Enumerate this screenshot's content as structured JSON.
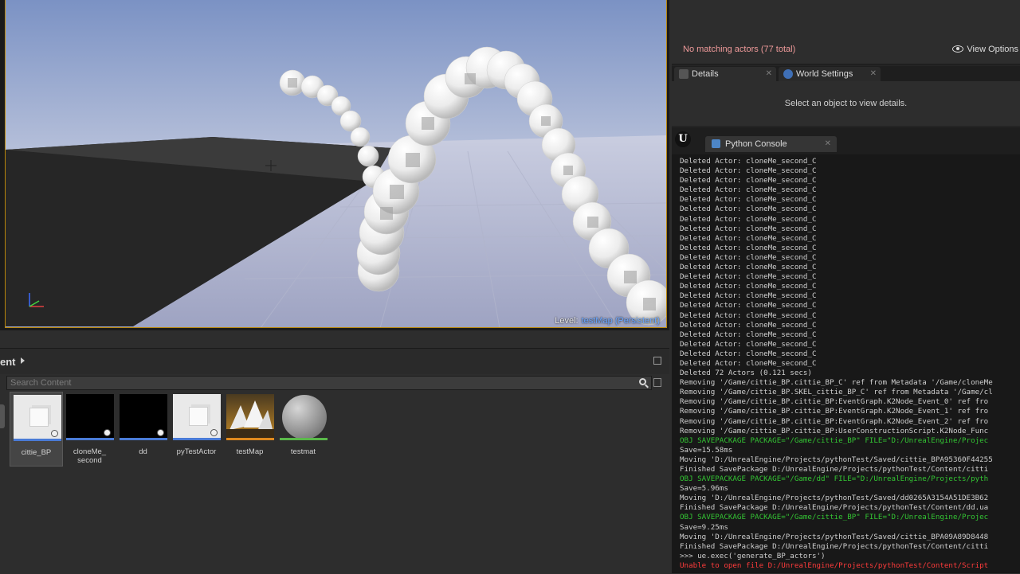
{
  "viewport": {
    "level_label": "Level:",
    "level_name": "testMap (Persistent)"
  },
  "content_browser": {
    "title": "ent",
    "search_placeholder": "Search Content",
    "assets": [
      {
        "label": "cittie_BP",
        "thumb": "blueprint-cube",
        "color": "#4a7bd6"
      },
      {
        "label": "cloneMe_\nsecond",
        "thumb": "blueprint-black",
        "color": "#4a7bd6"
      },
      {
        "label": "dd",
        "thumb": "blueprint-black",
        "color": "#4a7bd6"
      },
      {
        "label": "pyTestActor",
        "thumb": "blueprint-cube",
        "color": "#4a7bd6"
      },
      {
        "label": "testMap",
        "thumb": "map",
        "color": "#e08a1e"
      },
      {
        "label": "testmat",
        "thumb": "material-sphere",
        "color": "#5ab84a"
      }
    ]
  },
  "outliner": {
    "status": "No matching actors (77 total)",
    "view_options": "View Options"
  },
  "details": {
    "tabs": [
      "Details",
      "World Settings"
    ],
    "message": "Select an object to view details."
  },
  "python_console": {
    "tab_label": "Python Console",
    "lines": [
      {
        "text": "Deleted Actor: cloneMe_second_C",
        "kind": "normal"
      },
      {
        "text": "Deleted Actor: cloneMe_second_C",
        "kind": "normal"
      },
      {
        "text": "Deleted Actor: cloneMe_second_C",
        "kind": "normal"
      },
      {
        "text": "Deleted Actor: cloneMe_second_C",
        "kind": "normal"
      },
      {
        "text": "Deleted Actor: cloneMe_second_C",
        "kind": "normal"
      },
      {
        "text": "Deleted Actor: cloneMe_second_C",
        "kind": "normal"
      },
      {
        "text": "Deleted Actor: cloneMe_second_C",
        "kind": "normal"
      },
      {
        "text": "Deleted Actor: cloneMe_second_C",
        "kind": "normal"
      },
      {
        "text": "Deleted Actor: cloneMe_second_C",
        "kind": "normal"
      },
      {
        "text": "Deleted Actor: cloneMe_second_C",
        "kind": "normal"
      },
      {
        "text": "Deleted Actor: cloneMe_second_C",
        "kind": "normal"
      },
      {
        "text": "Deleted Actor: cloneMe_second_C",
        "kind": "normal"
      },
      {
        "text": "Deleted Actor: cloneMe_second_C",
        "kind": "normal"
      },
      {
        "text": "Deleted Actor: cloneMe_second_C",
        "kind": "normal"
      },
      {
        "text": "Deleted Actor: cloneMe_second_C",
        "kind": "normal"
      },
      {
        "text": "Deleted Actor: cloneMe_second_C",
        "kind": "normal"
      },
      {
        "text": "Deleted Actor: cloneMe_second_C",
        "kind": "normal"
      },
      {
        "text": "Deleted Actor: cloneMe_second_C",
        "kind": "normal"
      },
      {
        "text": "Deleted Actor: cloneMe_second_C",
        "kind": "normal"
      },
      {
        "text": "Deleted Actor: cloneMe_second_C",
        "kind": "normal"
      },
      {
        "text": "Deleted Actor: cloneMe_second_C",
        "kind": "normal"
      },
      {
        "text": "Deleted Actor: cloneMe_second_C",
        "kind": "normal"
      },
      {
        "text": "Deleted 72 Actors (0.121 secs)",
        "kind": "normal"
      },
      {
        "text": "Removing '/Game/cittie_BP.cittie_BP_C' ref from Metadata '/Game/cloneMe",
        "kind": "normal"
      },
      {
        "text": "Removing '/Game/cittie_BP.SKEL_cittie_BP_C' ref from Metadata '/Game/cl",
        "kind": "normal"
      },
      {
        "text": "Removing '/Game/cittie_BP.cittie_BP:EventGraph.K2Node_Event_0' ref fro",
        "kind": "normal"
      },
      {
        "text": "Removing '/Game/cittie_BP.cittie_BP:EventGraph.K2Node_Event_1' ref fro",
        "kind": "normal"
      },
      {
        "text": "Removing '/Game/cittie_BP.cittie_BP:EventGraph.K2Node_Event_2' ref fro",
        "kind": "normal"
      },
      {
        "text": "Removing '/Game/cittie_BP.cittie_BP:UserConstructionScript.K2Node_Func",
        "kind": "normal"
      },
      {
        "text": "OBJ SAVEPACKAGE PACKAGE=\"/Game/cittie_BP\" FILE=\"D:/UnrealEngine/Projec",
        "kind": "green"
      },
      {
        "text": "Save=15.58ms",
        "kind": "normal"
      },
      {
        "text": "Moving 'D:/UnrealEngine/Projects/pythonTest/Saved/cittie_BPA95360F44255",
        "kind": "normal"
      },
      {
        "text": "Finished SavePackage D:/UnrealEngine/Projects/pythonTest/Content/citti",
        "kind": "normal"
      },
      {
        "text": "OBJ SAVEPACKAGE PACKAGE=\"/Game/dd\" FILE=\"D:/UnrealEngine/Projects/pyth",
        "kind": "green"
      },
      {
        "text": "Save=5.96ms",
        "kind": "normal"
      },
      {
        "text": "Moving 'D:/UnrealEngine/Projects/pythonTest/Saved/dd0265A3154A51DE3B62",
        "kind": "normal"
      },
      {
        "text": "Finished SavePackage D:/UnrealEngine/Projects/pythonTest/Content/dd.ua",
        "kind": "normal"
      },
      {
        "text": "OBJ SAVEPACKAGE PACKAGE=\"/Game/cittie_BP\" FILE=\"D:/UnrealEngine/Projec",
        "kind": "green"
      },
      {
        "text": "Save=9.25ms",
        "kind": "normal"
      },
      {
        "text": "Moving 'D:/UnrealEngine/Projects/pythonTest/Saved/cittie_BPA09A89D8448",
        "kind": "normal"
      },
      {
        "text": "Finished SavePackage D:/UnrealEngine/Projects/pythonTest/Content/citti",
        "kind": "normal"
      },
      {
        "text": ">>> ue.exec('generate_BP_actors')",
        "kind": "normal"
      },
      {
        "text": "Unable to open file D:/UnrealEngine/Projects/pythonTest/Content/Script",
        "kind": "red"
      }
    ]
  },
  "colors": {
    "viewport_border": "#b8860b",
    "outliner_status": "#ef9a9a",
    "log_green": "#33c433",
    "log_red": "#ff3b3b"
  }
}
